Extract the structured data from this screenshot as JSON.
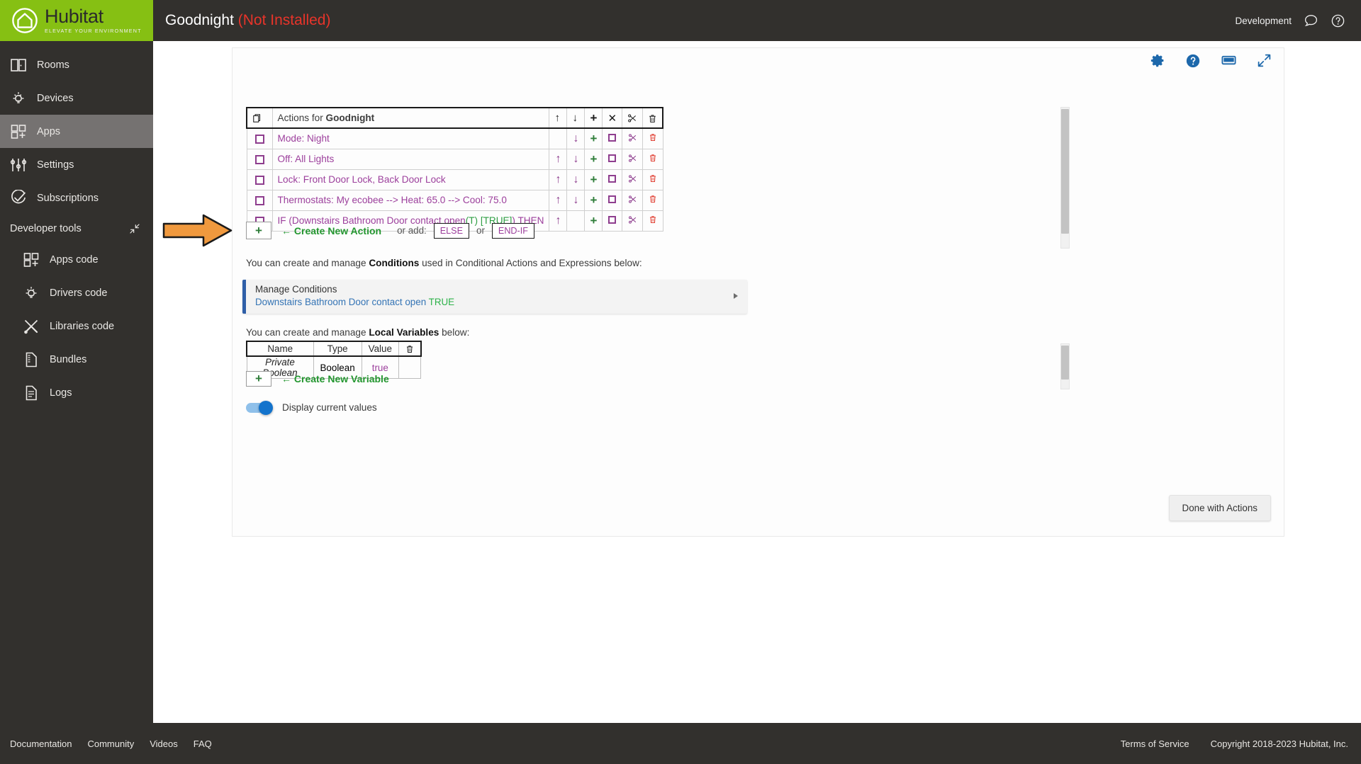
{
  "brand": {
    "name": "Hubitat",
    "tagline": "ELEVATE YOUR ENVIRONMENT",
    "logo_icon": "house-in-circle-icon"
  },
  "topbar": {
    "app_name": "Goodnight",
    "app_status": "(Not Installed)",
    "environment": "Development",
    "chat_icon": "chat-bubble-icon",
    "help_icon": "help-circle-icon"
  },
  "sidebar": {
    "items": [
      {
        "label": "Rooms",
        "icon": "rooms-icon",
        "active": false
      },
      {
        "label": "Devices",
        "icon": "lightbulb-icon",
        "active": false
      },
      {
        "label": "Apps",
        "icon": "apps-grid-icon",
        "active": true
      },
      {
        "label": "Settings",
        "icon": "sliders-icon",
        "active": false
      },
      {
        "label": "Subscriptions",
        "icon": "check-circle-icon",
        "active": false
      }
    ],
    "developer_tools": {
      "label": "Developer tools",
      "collapse_icon": "collapse-arrows-icon",
      "items": [
        {
          "label": "Apps code",
          "icon": "apps-grid-icon"
        },
        {
          "label": "Drivers code",
          "icon": "lightbulb-icon"
        },
        {
          "label": "Libraries code",
          "icon": "tools-icon"
        },
        {
          "label": "Bundles",
          "icon": "document-icon"
        },
        {
          "label": "Logs",
          "icon": "logs-icon"
        }
      ]
    }
  },
  "card_tools": [
    {
      "name": "gear-icon",
      "label": "Settings"
    },
    {
      "name": "help-circle-icon",
      "label": "Help"
    },
    {
      "name": "monitor-icon",
      "label": "Display"
    },
    {
      "name": "expand-arrows-icon",
      "label": "Full screen"
    }
  ],
  "actions_table": {
    "header": {
      "copy_icon": "copy-pages-icon",
      "title_prefix": "Actions for ",
      "title_name": "Goodnight",
      "icons": [
        {
          "name": "arrow-up-icon",
          "glyph": "↑"
        },
        {
          "name": "arrow-down-icon",
          "glyph": "↓"
        },
        {
          "name": "plus-icon",
          "glyph": "+"
        },
        {
          "name": "close-x-icon",
          "glyph": "✕"
        },
        {
          "name": "scissors-icon",
          "glyph": "✂"
        },
        {
          "name": "trash-icon",
          "glyph": "Ὕ1"
        }
      ]
    },
    "rows": [
      {
        "text": "Mode: Night",
        "up": false,
        "down": true
      },
      {
        "text": "Off: All Lights",
        "up": true,
        "down": true
      },
      {
        "text": "Lock: Front Door Lock, Back Door Lock",
        "up": true,
        "down": true
      },
      {
        "text": "Thermostats: My ecobee --> Heat: 65.0 --> Cool: 75.0",
        "up": true,
        "down": true
      },
      {
        "text": "IF (Downstairs Bathroom Door contact open(T) [TRUE]) THEN",
        "up": true,
        "down": false,
        "green_parts": [
          "(T)",
          "[TRUE]"
        ]
      }
    ]
  },
  "new_action": {
    "plus_glyph": "+",
    "create_label": "← Create New Action",
    "or_add_label": "or add:",
    "else_label": "ELSE",
    "or_label": "or",
    "endif_label": "END-IF",
    "annotation_icon": "orange-arrow-pointer",
    "annotation_color": "#f0993e"
  },
  "conditions": {
    "hint_before": "You can create and manage ",
    "hint_bold": "Conditions",
    "hint_after": " used in Conditional Actions and Expressions below:",
    "panel_title": "Manage Conditions",
    "panel_condition": "Downstairs Bathroom Door contact open",
    "panel_value": "TRUE",
    "caret_icon": "chevron-right-icon",
    "accent_color": "#2f5fa8"
  },
  "variables": {
    "hint_before": "You can create and manage ",
    "hint_bold": "Local Variables",
    "hint_after": " below:",
    "columns": [
      "Name",
      "Type",
      "Value"
    ],
    "delete_icon": "trash-icon",
    "rows": [
      {
        "name": "Private Boolean",
        "type": "Boolean",
        "value": "true"
      }
    ],
    "plus_glyph": "+",
    "create_label": "← Create New Variable"
  },
  "display_values": {
    "label": "Display current values",
    "on": true
  },
  "done_button": {
    "label": "Done with Actions"
  },
  "footer": {
    "links": [
      "Documentation",
      "Community",
      "Videos",
      "FAQ"
    ],
    "terms": "Terms of Service",
    "copyright": "Copyright 2018-2023 Hubitat, Inc."
  }
}
